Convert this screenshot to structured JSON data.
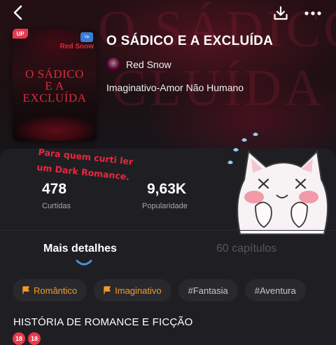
{
  "header": {
    "back_icon": "back-arrow-icon",
    "download_icon": "download-icon",
    "more_icon": "more-dots-icon"
  },
  "background": {
    "ghost_line1": "O SÁDICO",
    "ghost_line2": "CLUÍDA"
  },
  "cover": {
    "badge": "UP",
    "mini_badge": "Vip",
    "author": "Red Snow",
    "title_line1": "O SÁDICO",
    "title_line2": "E A",
    "title_line3": "EXCLUÍDA"
  },
  "book": {
    "title": "O SÁDICO E A EXCLUÍDA",
    "author": "Red Snow",
    "genre": "Imaginativo-Amor Não Humano"
  },
  "note": {
    "line1": "Para quem curti ler",
    "line2": "um Dark Romance."
  },
  "stats": [
    {
      "value": "478",
      "label": "Curtidas"
    },
    {
      "value": "9,63K",
      "label": "Popularidade"
    }
  ],
  "tabs": {
    "details": "Mais detalhes",
    "chapters": "60 capítulos",
    "active": "details"
  },
  "tags": [
    {
      "label": "Romântico",
      "hot": true
    },
    {
      "label": "Imaginativo",
      "hot": true
    },
    {
      "label": "#Fantasia",
      "hot": false
    },
    {
      "label": "#Aventura",
      "hot": false
    }
  ],
  "section": {
    "heading": "HISTÓRIA DE ROMANCE E FICÇÃO",
    "age_badge": "18"
  },
  "colors": {
    "accent_red": "#e8283c",
    "tag_orange": "#f39a2c",
    "indicator_blue": "#4a90e2",
    "panel": "#1f1f23"
  }
}
